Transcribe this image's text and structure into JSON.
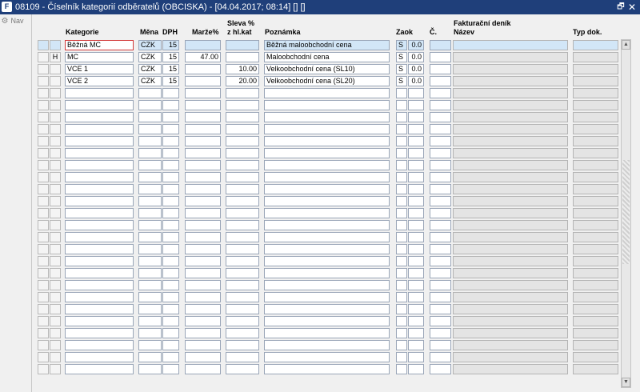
{
  "window": {
    "icon_letter": "F",
    "title": "08109 - Číselník kategorií odběratelů (OBCISKA) - [04.04.2017; 08:14] [] []",
    "restore_glyph": "🗗",
    "close_glyph": "✕"
  },
  "nav": {
    "label": "Nav",
    "icon": "gear-icon"
  },
  "headers": {
    "kategorie": "Kategorie",
    "mena": "Měna",
    "dph": "DPH",
    "marze": "Marže%",
    "sleva_line1": "Sleva %",
    "sleva_line2": "z hl.kat",
    "poznamka": "Poznámka",
    "zaok": "Zaok",
    "c": "Č.",
    "fakt_line1": "Fakturační deník",
    "fakt_line2": "Název",
    "typ": "Typ dok."
  },
  "rows": [
    {
      "flag": "",
      "kategorie": "Běžná MC",
      "mena": "CZK",
      "dph": "15",
      "marze": "",
      "sleva": "",
      "poznamka": "Běžná maloobchodní cena",
      "zaok_code": "S",
      "zaok_val": "0.0",
      "c": "",
      "nazev": "",
      "typ": ""
    },
    {
      "flag": "H",
      "kategorie": "MC",
      "mena": "CZK",
      "dph": "15",
      "marze": "47.00",
      "sleva": "",
      "poznamka": "Maloobchodní cena",
      "zaok_code": "S",
      "zaok_val": "0.0",
      "c": "",
      "nazev": "",
      "typ": ""
    },
    {
      "flag": "",
      "kategorie": "VCE 1",
      "mena": "CZK",
      "dph": "15",
      "marze": "",
      "sleva": "10.00",
      "poznamka": "Velkoobchodní cena (SL10)",
      "zaok_code": "S",
      "zaok_val": "0.0",
      "c": "",
      "nazev": "",
      "typ": ""
    },
    {
      "flag": "",
      "kategorie": "VCE 2",
      "mena": "CZK",
      "dph": "15",
      "marze": "",
      "sleva": "20.00",
      "poznamka": "Velkoobchodní cena (SL20)",
      "zaok_code": "S",
      "zaok_val": "0.0",
      "c": "",
      "nazev": "",
      "typ": ""
    }
  ],
  "grid": {
    "total_rows": 28,
    "selected_row": 0,
    "focused_field": "kategorie"
  },
  "colors": {
    "titlebar": "#1f3f7a",
    "selected_row": "#d2e6f7",
    "focus_border": "#d23a3a"
  }
}
